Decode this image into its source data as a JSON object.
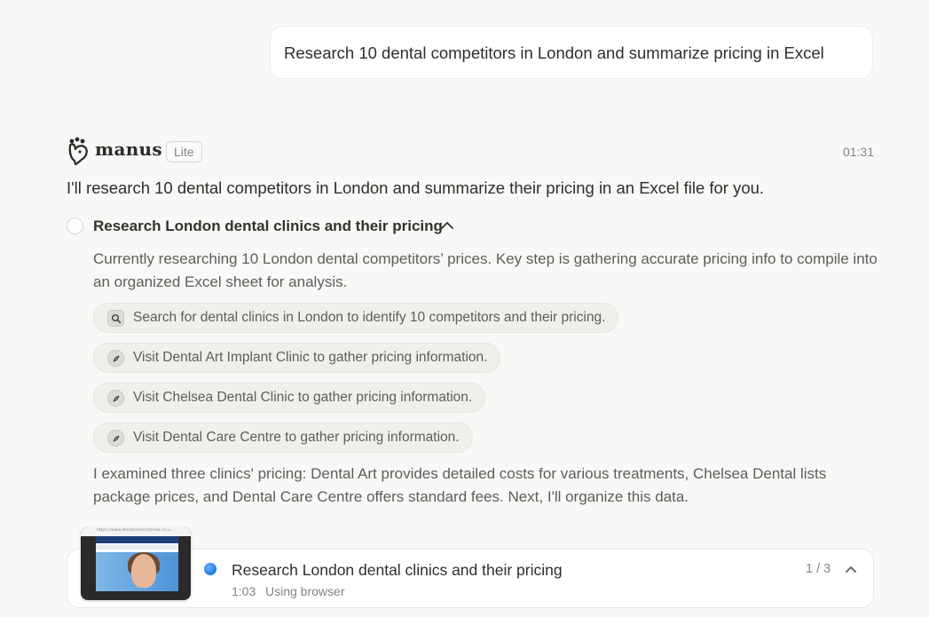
{
  "user_message": "Research 10 dental competitors in London and summarize pricing in Excel",
  "agent": {
    "brand": "manus",
    "badge": "Lite",
    "timestamp": "01:31",
    "intro": "I'll research 10 dental competitors in London and summarize their pricing in an Excel file for you."
  },
  "step": {
    "title": "Research London dental clinics and their pricing",
    "description": "Currently researching 10 London dental competitors’ prices. Key step is gathering accurate pricing info to compile into an organized Excel sheet for analysis.",
    "actions": [
      {
        "icon": "search-icon",
        "label": "Search for dental clinics in London to identify 10 competitors and their pricing."
      },
      {
        "icon": "compass-icon",
        "label": "Visit Dental Art Implant Clinic to gather pricing information."
      },
      {
        "icon": "compass-icon",
        "label": "Visit Chelsea Dental Clinic to gather pricing information."
      },
      {
        "icon": "compass-icon",
        "label": "Visit Dental Care Centre to gather pricing information."
      }
    ],
    "summary": "I examined three clinics' pricing: Dental Art provides detailed costs for various treatments, Chelsea Dental lists package prices, and Dental Care Centre offers standard fees. Next, I'll organize this data."
  },
  "status": {
    "title": "Research London dental clinics and their pricing",
    "time": "1:03",
    "text": "Using browser",
    "page": "1 / 3",
    "thumb_url": "https://www.dentalcarecentreuk.co.u..."
  },
  "colors": {
    "background": "#f8f8f7",
    "accent": "#1f7ae0",
    "muted_text": "#858481"
  }
}
